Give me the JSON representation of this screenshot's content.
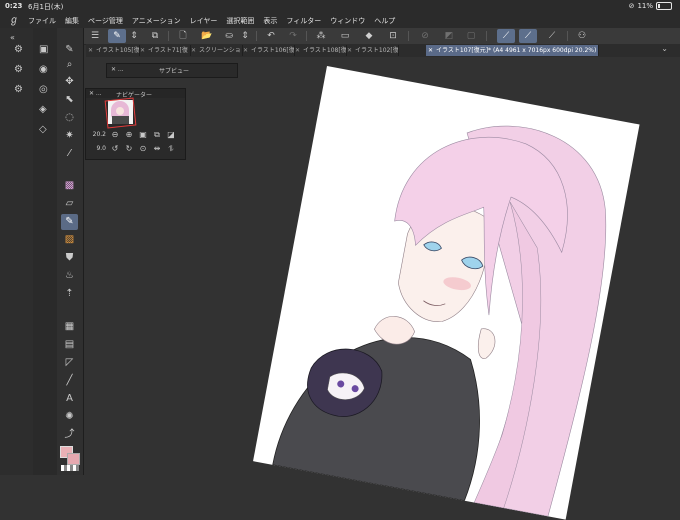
{
  "status": {
    "time": "0:23",
    "date": "6月1日(木)",
    "battery": "11%"
  },
  "menu": {
    "items": [
      "ファイル",
      "編集",
      "ページ管理",
      "アニメーション",
      "レイヤー",
      "選択範囲",
      "表示",
      "フィルター",
      "ウィンドウ",
      "ヘルプ"
    ]
  },
  "tabs": [
    {
      "label": "イラスト105[復",
      "active": false
    },
    {
      "label": "イラスト71[復",
      "active": false
    },
    {
      "label": "スクリーンショ",
      "active": false
    },
    {
      "label": "イラスト106[復",
      "active": false
    },
    {
      "label": "イラスト108[復",
      "active": false
    },
    {
      "label": "イラスト102[復",
      "active": false
    },
    {
      "label": "イラスト107[復元]* (A4 4961 x 7016px 600dpi 20.2%)",
      "active": true
    }
  ],
  "panels": {
    "subview": {
      "title": "サブビュー",
      "controls": "✕ ..."
    },
    "navigator": {
      "title": "ナビゲーター",
      "controls": "✕ ...",
      "zoom": "20.2",
      "rotation": "9.0"
    }
  },
  "colors": {
    "main": "#e9b0b5",
    "sub": "#e6a9b0",
    "accent": "#5a6a88",
    "canvas_bg": "#323232"
  }
}
